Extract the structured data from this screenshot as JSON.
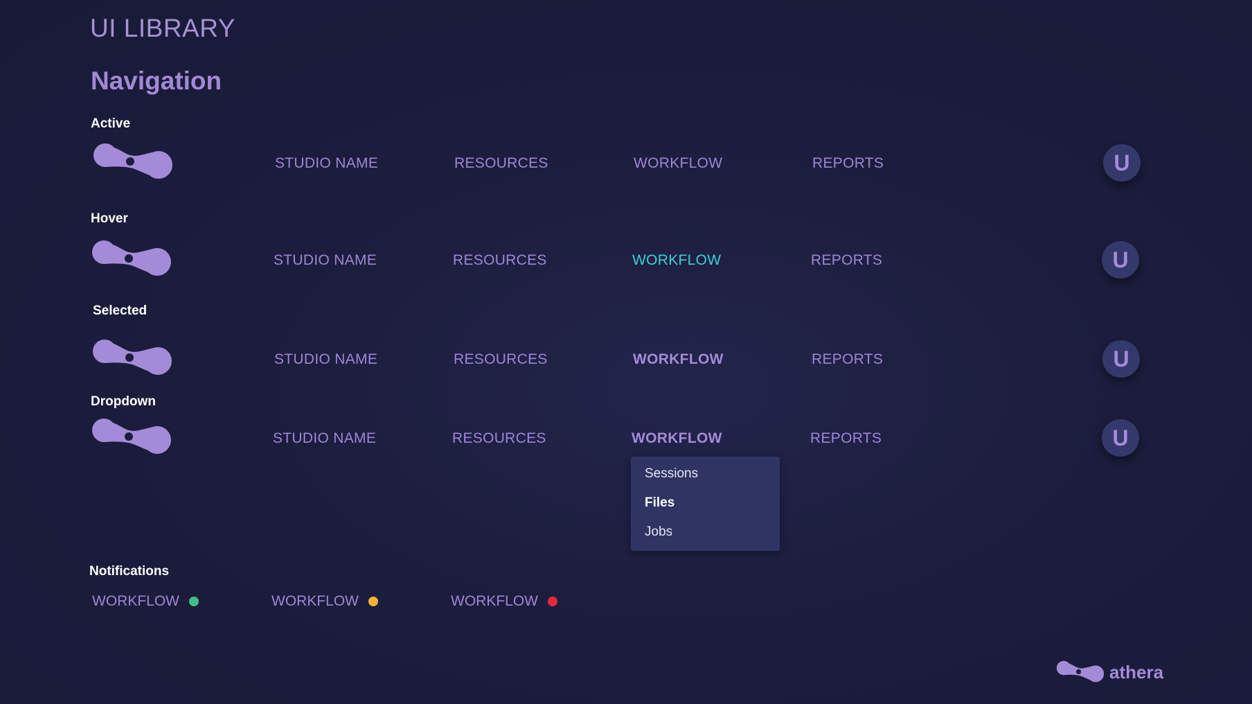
{
  "header": {
    "library_title": "UI LIBRARY",
    "section_title": "Navigation"
  },
  "colors": {
    "background": "#1c1d3d",
    "accent": "#a48bd8",
    "hover": "#3fd0d7",
    "dropdown_bg": "#2f3463",
    "avatar_bg": "#35386b"
  },
  "states": [
    {
      "label": "Active",
      "logo_icon": "athera-logo-icon",
      "items": [
        "STUDIO NAME",
        "RESOURCES",
        "WORKFLOW",
        "REPORTS"
      ],
      "avatar": "U"
    },
    {
      "label": "Hover",
      "logo_icon": "athera-logo-icon",
      "items": [
        "STUDIO NAME",
        "RESOURCES",
        "WORKFLOW",
        "REPORTS"
      ],
      "avatar": "U",
      "hovered_item": "WORKFLOW"
    },
    {
      "label": "Selected",
      "logo_icon": "athera-logo-icon",
      "items": [
        "STUDIO NAME",
        "RESOURCES",
        "WORKFLOW",
        "REPORTS"
      ],
      "avatar": "U",
      "selected_item": "WORKFLOW"
    },
    {
      "label": "Dropdown",
      "logo_icon": "athera-logo-icon",
      "items": [
        "STUDIO NAME",
        "RESOURCES",
        "WORKFLOW",
        "REPORTS"
      ],
      "avatar": "U",
      "selected_item": "WORKFLOW"
    }
  ],
  "dropdown": {
    "items": [
      "Sessions",
      "Files",
      "Jobs"
    ],
    "active_item": "Files"
  },
  "notifications": {
    "label": "Notifications",
    "items": [
      {
        "label": "WORKFLOW",
        "dot_color": "#3fbf86"
      },
      {
        "label": "WORKFLOW",
        "dot_color": "#f4b13a"
      },
      {
        "label": "WORKFLOW",
        "dot_color": "#e8283c"
      }
    ]
  },
  "brand": {
    "name": "athera",
    "icon": "athera-logo-icon"
  }
}
